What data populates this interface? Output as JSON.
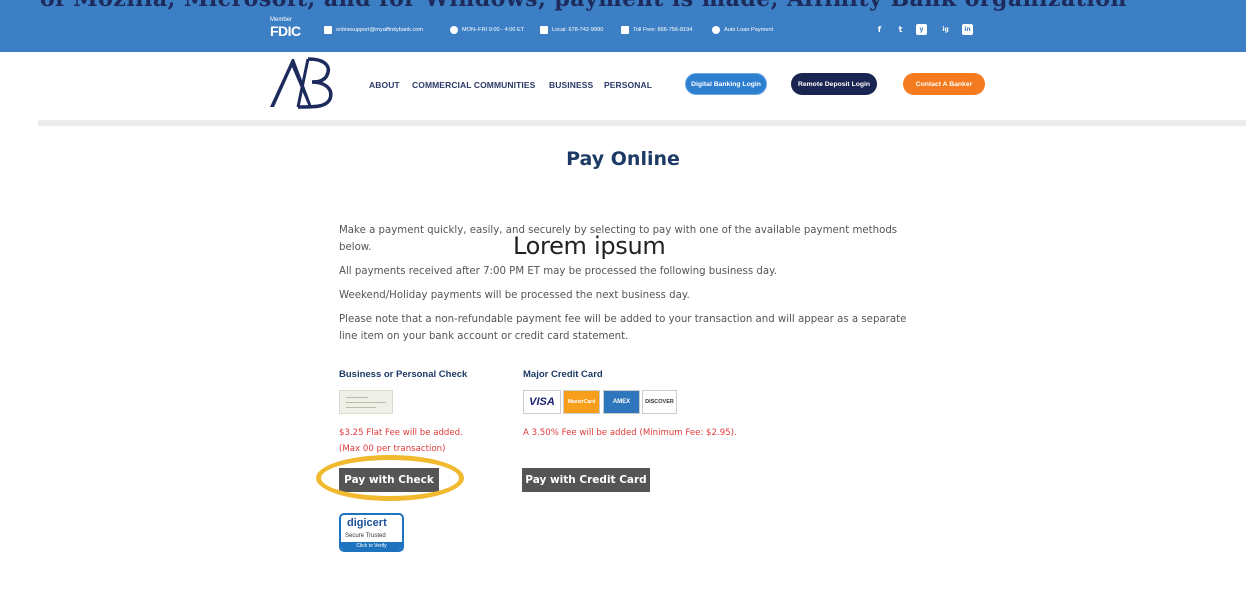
{
  "banner": {
    "text": "of Mozilla, Microsoft, and for Windows, payment is made, Affinity Bank organization"
  },
  "topbar": {
    "fdic_member": "Member",
    "fdic_name": "FDIC",
    "email": "onlinesupport@myaffinitybank.com",
    "hours": "MON–FRI 9:00 - 4:00 ET",
    "local": "Local: 678-742-9990",
    "toll_free": "Toll Free: 866-756-8194",
    "auto_loan": "Auto Loan Payment",
    "social": [
      "f",
      "t",
      "y",
      "ig",
      "in"
    ]
  },
  "nav": {
    "logo_text": "AB",
    "links": [
      "ABOUT",
      "COMMERCIAL COMMUNITIES",
      "BUSINESS",
      "PERSONAL"
    ],
    "digital_banking": "Digital Banking Login",
    "remote_deposit": "Remote Deposit Login",
    "contact": "Contact A Banker"
  },
  "colors": {
    "topbar": "#3d7fc4",
    "navy": "#1d3a66",
    "orange": "#f47b20",
    "pill_blue": "#2f7fd1",
    "dark_pill": "#1b2552",
    "fee_red": "#e03a3a",
    "button": "#555555",
    "highlight": "#f0b92e"
  },
  "page": {
    "title": "Pay Online",
    "para1": "Make a payment quickly, easily, and securely by selecting to pay with one of the available payment methods below.",
    "para2": "All payments received after 7:00 PM ET may be processed the following business day.",
    "para3": "Weekend/Holiday payments will be processed the next business day.",
    "para4": "Please note that a non-refundable payment fee will be added to your transaction and will appear as a separate line item on your bank account or credit card statement.",
    "overlay": "Lorem ipsum"
  },
  "check": {
    "heading": "Business or Personal Check",
    "fee1": "$3.25 Flat Fee will be added.",
    "fee2": "(Max                    00 per transaction)",
    "button": "Pay with Check"
  },
  "credit": {
    "heading": "Major Credit Card",
    "fee1": "A 3.50% Fee will be added (Minimum Fee: $2.95).",
    "button": "Pay with Credit Card",
    "cards": [
      "VISA",
      "MasterCard",
      "AMEX",
      "DISCOVER"
    ]
  },
  "digicert": {
    "brand": "digicert",
    "sub": "Secure  Trusted",
    "verify": "Click to Verify"
  }
}
